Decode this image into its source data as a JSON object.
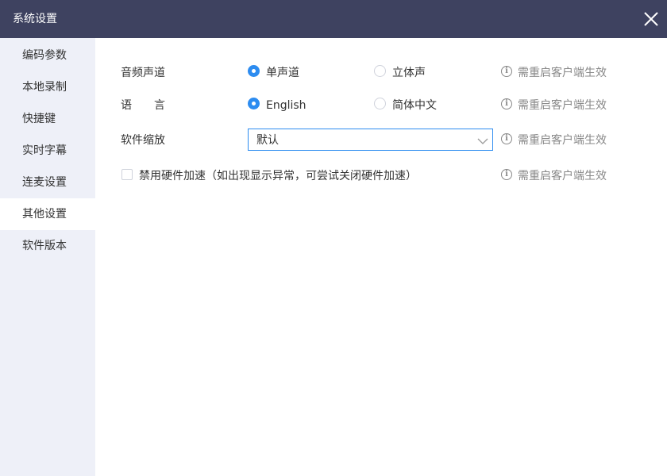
{
  "window": {
    "title": "系统设置",
    "close_icon": "close-icon"
  },
  "sidebar": {
    "items": [
      {
        "label": "编码参数",
        "active": false
      },
      {
        "label": "本地录制",
        "active": false
      },
      {
        "label": "快捷键",
        "active": false
      },
      {
        "label": "实时字幕",
        "active": false
      },
      {
        "label": "连麦设置",
        "active": false
      },
      {
        "label": "其他设置",
        "active": true
      },
      {
        "label": "软件版本",
        "active": false
      }
    ]
  },
  "settings": {
    "audio_channel": {
      "label": "音频声道",
      "options": [
        {
          "label": "单声道",
          "selected": true
        },
        {
          "label": "立体声",
          "selected": false
        }
      ],
      "hint": "需重启客户端生效"
    },
    "language": {
      "label": "语　　言",
      "options": [
        {
          "label": "English",
          "selected": true
        },
        {
          "label": "简体中文",
          "selected": false
        }
      ],
      "hint": "需重启客户端生效"
    },
    "zoom": {
      "label": "软件缩放",
      "selected_value": "默认",
      "hint": "需重启客户端生效"
    },
    "hardware_accel": {
      "label": "禁用硬件加速（如出现显示异常，可尝试关闭硬件加速）",
      "checked": false,
      "hint": "需重启客户端生效"
    },
    "info_glyph": "i"
  },
  "colors": {
    "titlebar": "#3e4260",
    "sidebar": "#eef0f8",
    "accent": "#2d8cf0",
    "hint": "#888888"
  }
}
